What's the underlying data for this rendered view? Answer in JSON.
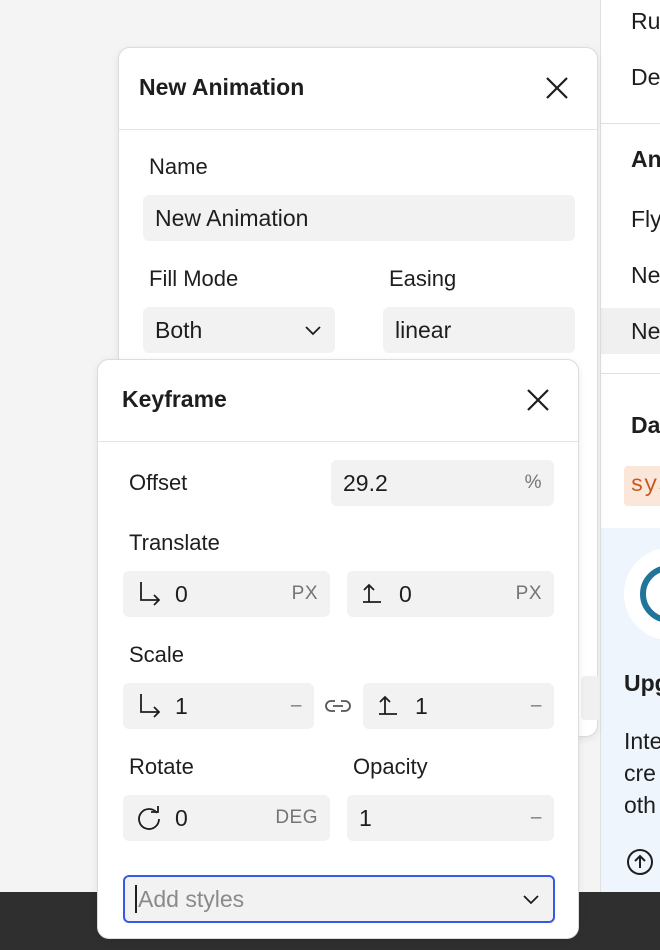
{
  "sidebar": {
    "items": [
      "Ru",
      "De"
    ],
    "section2_title": "An",
    "items2": [
      "Fly",
      "Ne",
      "Ne"
    ],
    "section3_title": "Da",
    "badge": "sys",
    "promo_title": "Upg",
    "promo_lines": [
      "Inte",
      "cre",
      "oth"
    ]
  },
  "animation_panel": {
    "title": "New Animation",
    "name_label": "Name",
    "name_value": "New Animation",
    "fill_mode_label": "Fill Mode",
    "fill_mode_value": "Both",
    "easing_label": "Easing",
    "easing_value": "linear"
  },
  "keyframe_panel": {
    "title": "Keyframe",
    "offset_label": "Offset",
    "offset_value": "29.2",
    "offset_unit": "%",
    "translate_label": "Translate",
    "translate_x": "0",
    "translate_y": "0",
    "translate_unit": "PX",
    "scale_label": "Scale",
    "scale_x": "1",
    "scale_y": "1",
    "scale_unit": "–",
    "rotate_label": "Rotate",
    "rotate_value": "0",
    "rotate_unit": "DEG",
    "opacity_label": "Opacity",
    "opacity_value": "1",
    "opacity_unit": "–",
    "add_styles_placeholder": "Add styles"
  },
  "icons": {
    "close": "close-icon",
    "chevron": "chevron-down-icon",
    "axis_x": "axis-x-icon",
    "axis_y": "axis-y-icon",
    "link": "link-icon",
    "rotate": "rotate-icon",
    "wordpress": "wordpress-logo-icon",
    "arrow_up": "arrow-up-circle-icon"
  },
  "colors": {
    "accent": "#3858e9",
    "badge_text": "#c65a1e",
    "wordpress_blue": "#21759b"
  }
}
